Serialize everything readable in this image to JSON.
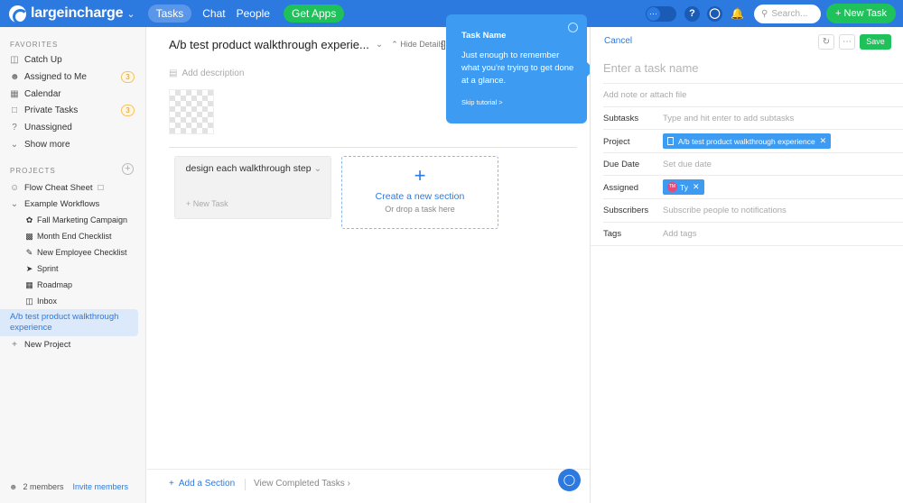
{
  "topbar": {
    "brand": "largeincharge",
    "tabs": [
      "Tasks",
      "Chat",
      "People"
    ],
    "get_apps": "Get Apps",
    "search_placeholder": "Search...",
    "new_task": "New Task"
  },
  "sidebar": {
    "favorites_title": "FAVORITES",
    "favorites": [
      {
        "label": "Catch Up",
        "icon": "inbox-icon"
      },
      {
        "label": "Assigned to Me",
        "icon": "person-icon",
        "badge": "3"
      },
      {
        "label": "Calendar",
        "icon": "calendar-icon"
      },
      {
        "label": "Private Tasks",
        "icon": "lock-icon",
        "badge": "3"
      },
      {
        "label": "Unassigned",
        "icon": "question-icon"
      },
      {
        "label": "Show more",
        "icon": "chevron-down-icon"
      }
    ],
    "projects_title": "PROJECTS",
    "projects": {
      "flow_cheat_sheet": "Flow Cheat Sheet",
      "example_workflows": "Example Workflows",
      "workflows": [
        "Fall Marketing Campaign",
        "Month End Checklist",
        "New Employee Checklist",
        "Sprint",
        "Roadmap",
        "Inbox"
      ],
      "active": "A/b test product walkthrough experience",
      "new_project": "New Project"
    },
    "members": "2 members",
    "invite": "Invite members"
  },
  "main": {
    "project_title": "A/b test product walkthrough experie...",
    "hide_details": "Hide Details",
    "add_description": "Add description",
    "section_title": "design each walkthrough step",
    "new_task": "New Task",
    "create_section": "Create a new section",
    "drop_task": "Or drop a task here",
    "add_section": "Add a Section",
    "view_completed": "View Completed Tasks"
  },
  "tooltip": {
    "title": "Task Name",
    "body": "Just enough to remember what you're trying to get done at a glance.",
    "skip": "Skip tutorial >"
  },
  "panel": {
    "cancel": "Cancel",
    "save": "Save",
    "task_name_placeholder": "Enter a task name",
    "note_placeholder": "Add note or attach file",
    "fields": {
      "subtasks_label": "Subtasks",
      "subtasks_placeholder": "Type and hit enter to add subtasks",
      "project_label": "Project",
      "project_value": "A/b test product walkthrough experience",
      "due_label": "Due Date",
      "due_placeholder": "Set due date",
      "assigned_label": "Assigned",
      "assigned_value": "Ty",
      "assigned_initials": "TM",
      "subscribers_label": "Subscribers",
      "subscribers_placeholder": "Subscribe people to notifications",
      "tags_label": "Tags",
      "tags_placeholder": "Add tags"
    }
  },
  "colors": {
    "brand_blue": "#2c79e0",
    "green": "#1fc25a",
    "tooltip_blue": "#3d9bf2",
    "badge_orange": "#d9992a"
  }
}
